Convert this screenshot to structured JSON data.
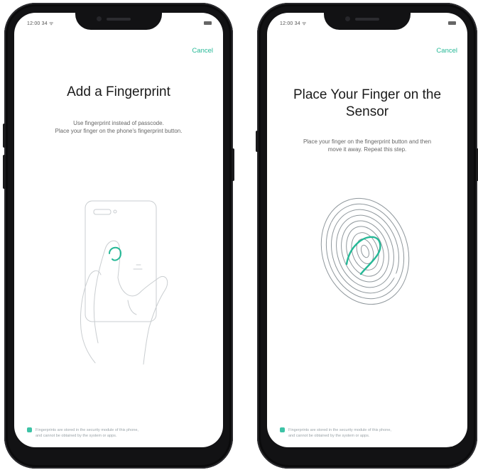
{
  "screens": [
    {
      "status_time": "12:00 34 ᯤ",
      "cancel_label": "Cancel",
      "title": "Add a Fingerprint",
      "description_line1": "Use fingerprint instead of passcode.",
      "description_line2": "Place your finger on the phone's fingerprint button.",
      "footer_line1": "Fingerprints are stored in the security module of this phone,",
      "footer_line2": "and cannot be obtained by the system or apps."
    },
    {
      "status_time": "12:00 34 ᯤ",
      "cancel_label": "Cancel",
      "title_line1": "Place Your Finger on the",
      "title_line2": "Sensor",
      "description_line1": "Place your finger on the fingerprint button and then",
      "description_line2": "move it away. Repeat this step.",
      "footer_line1": "Fingerprints are stored in the security module of this phone,",
      "footer_line2": "and cannot be obtained by the system or apps."
    }
  ],
  "colors": {
    "accent": "#25b896",
    "phone_body": "#121214",
    "title": "#1a1a1a",
    "body_text": "#666666",
    "footer_text": "#9aa3a8"
  },
  "icons": {
    "illustration_left": "hand-holding-phone-icon",
    "illustration_right": "fingerprint-icon"
  }
}
